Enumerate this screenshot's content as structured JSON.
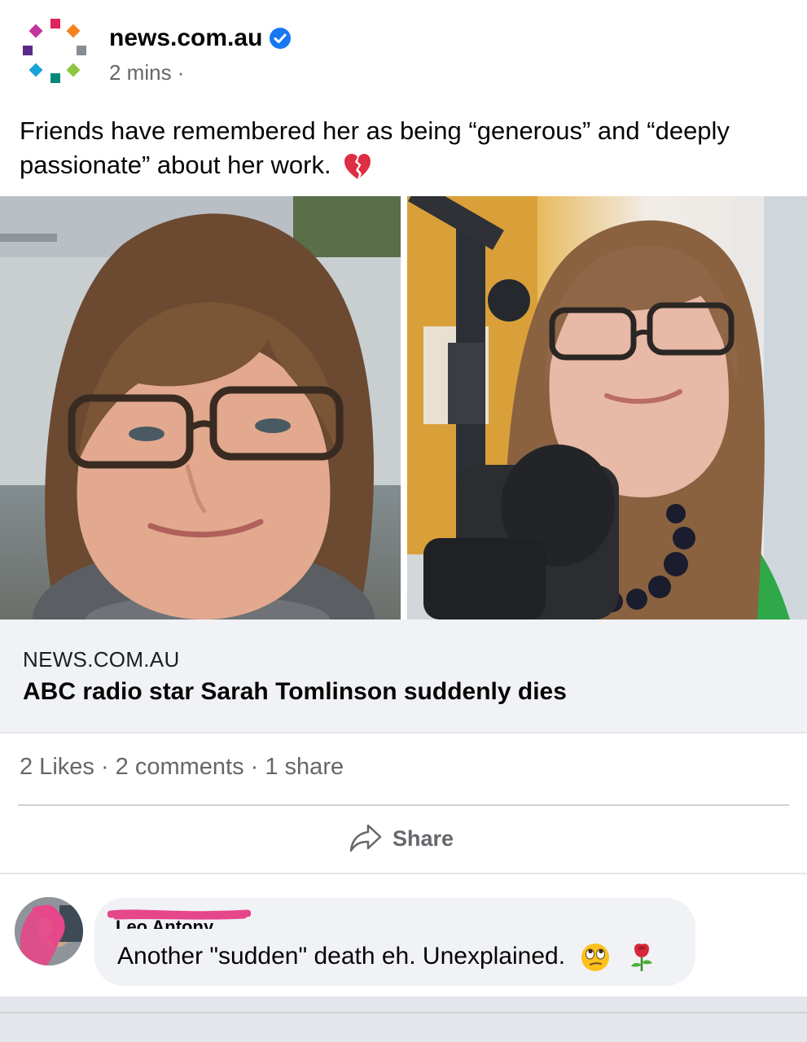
{
  "post": {
    "page_name": "news.com.au",
    "timestamp": "2 mins ·",
    "caption": "Friends have remembered her as being “generous” and “deeply passionate” about her work.",
    "caption_emoji": "broken-heart-icon"
  },
  "link_preview": {
    "domain": "NEWS.COM.AU",
    "title": "ABC radio star Sarah Tomlinson suddenly dies"
  },
  "engagement": {
    "stats": "2 Likes · 2 comments · 1 share",
    "share_label": "Share"
  },
  "comment": {
    "author": "Leo Antony",
    "text": "Another \"sudden\" death eh. Unexplained.",
    "emojis": [
      "eye-roll-icon",
      "rose-icon"
    ]
  },
  "colors": {
    "verified_blue": "#1877f2",
    "secondary_text": "#65676b",
    "link_bg": "#f0f2f5",
    "redaction_pink": "#e6478a"
  }
}
